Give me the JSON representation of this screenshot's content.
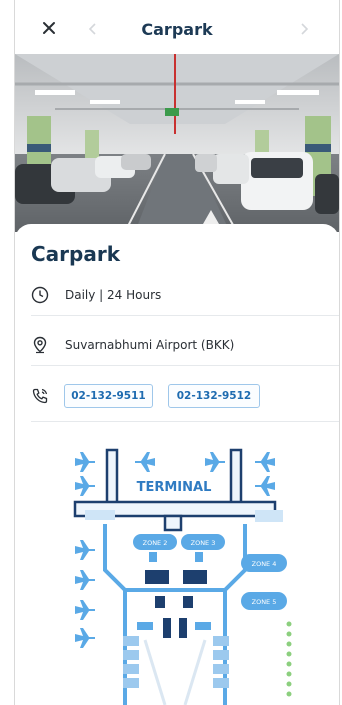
{
  "header": {
    "title": "Carpark"
  },
  "card": {
    "title": "Carpark",
    "hours": "Daily | 24 Hours",
    "location": "Suvarnabhumi Airport (BKK)",
    "phones": [
      "02-132-9511",
      "02-132-9512"
    ]
  },
  "map": {
    "terminal_label": "TERMINAL",
    "zones": [
      "ZONE 2",
      "ZONE 3",
      "ZONE 4",
      "ZONE 5"
    ]
  },
  "colors": {
    "accent": "#1e6bb0",
    "title": "#1a3853",
    "map_blue": "#5aa9e6",
    "map_dark": "#1d3f6e"
  },
  "icons": {
    "close": "close-icon",
    "prev": "chevron-left-icon",
    "next": "chevron-right-icon",
    "hours": "clock-icon",
    "location": "location-pin-icon",
    "phone": "phone-icon"
  }
}
